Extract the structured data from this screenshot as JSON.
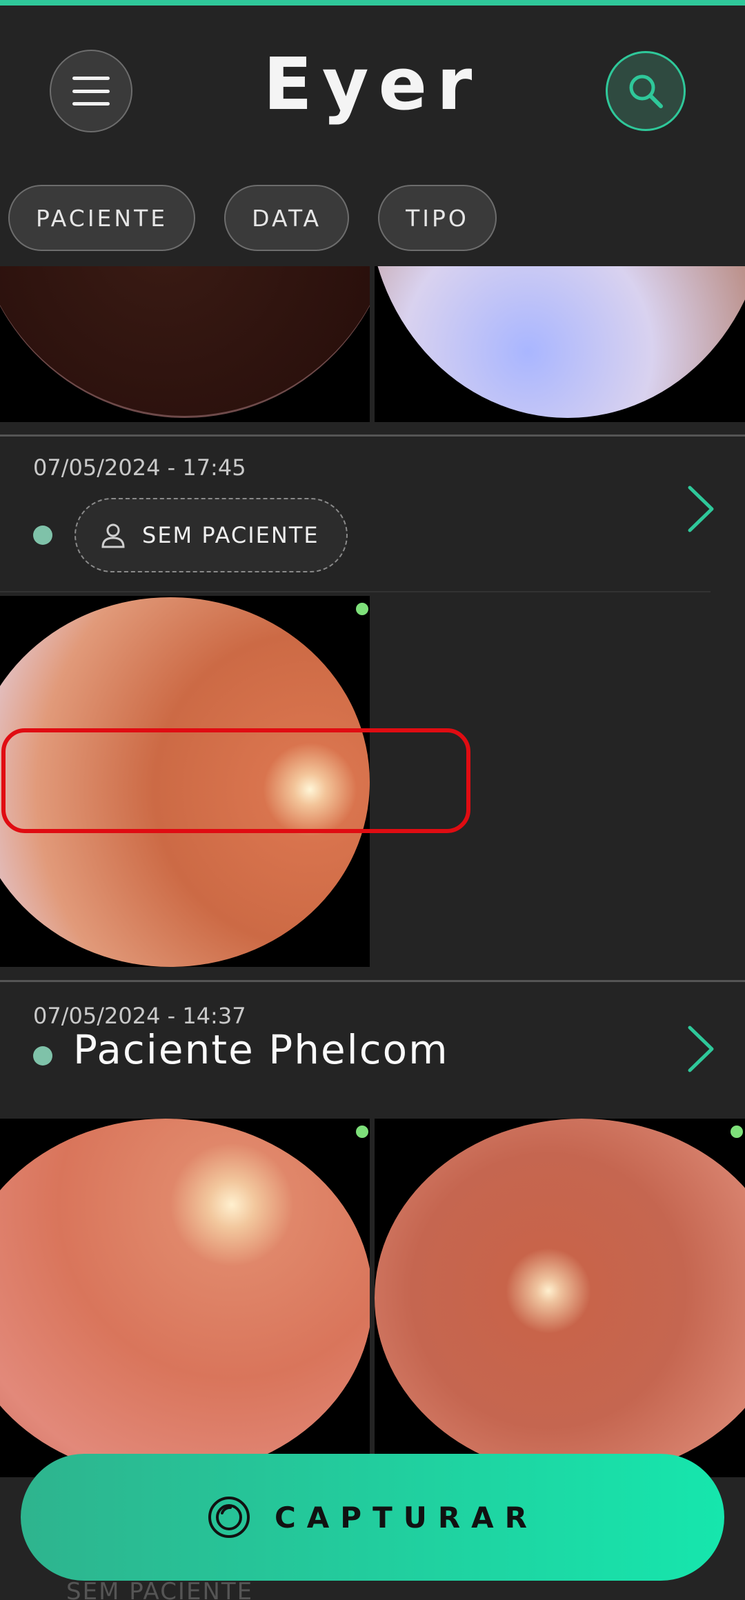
{
  "app": {
    "title": "Eyer",
    "accent_color": "#2fc89a"
  },
  "header": {
    "menu_icon": "hamburger-menu-icon",
    "search_icon": "search-icon"
  },
  "filters": [
    {
      "label": "PACIENTE"
    },
    {
      "label": "DATA"
    },
    {
      "label": "TIPO"
    }
  ],
  "exams": [
    {
      "datetime": "07/05/2024 - 17:45",
      "patient": "SEM PACIENTE",
      "has_patient": false,
      "images": 1,
      "status_color": "#7fc2a9"
    },
    {
      "datetime": "07/05/2024 - 14:37",
      "patient": "Paciente Phelcom",
      "has_patient": true,
      "images": 2,
      "status_color": "#7fc2a9"
    }
  ],
  "next_row_partial": {
    "patient": "SEM PACIENTE"
  },
  "capture_button": {
    "label": "CAPTURAR",
    "icon": "camera-lens-icon"
  }
}
